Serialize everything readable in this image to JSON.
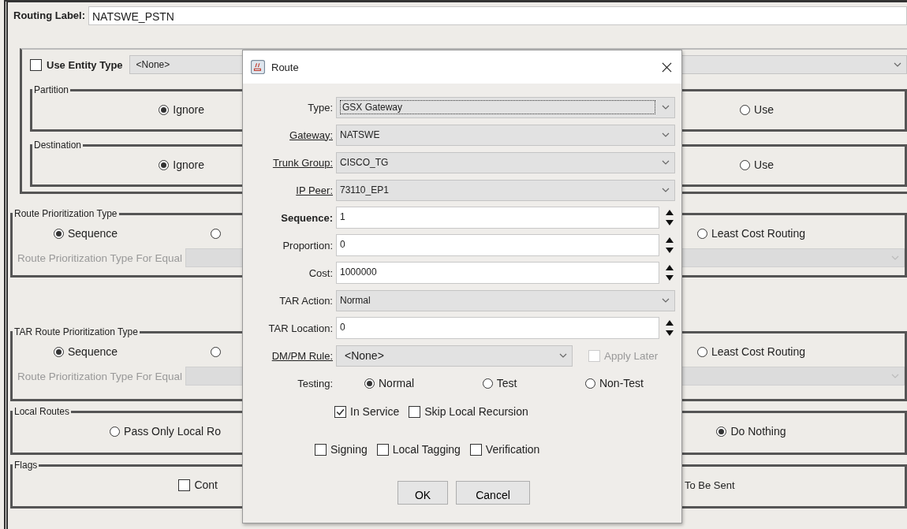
{
  "routing_label": {
    "label": "Routing Label:",
    "value": "NATSWE_PSTN"
  },
  "entity": {
    "use_entity_type": {
      "label": "Use Entity Type",
      "checked": false
    },
    "entity_type": "<None>",
    "groups": [
      {
        "title": "Partition",
        "options": [
          {
            "label": "Ignore",
            "selected": true
          },
          {
            "label": "Use",
            "selected": false
          }
        ]
      },
      {
        "title": "Destination",
        "options": [
          {
            "label": "Ignore",
            "selected": true
          },
          {
            "label": "Use",
            "selected": false
          }
        ]
      }
    ]
  },
  "prioritization": [
    {
      "title": "Route Prioritization Type",
      "options": [
        {
          "label": "Sequence",
          "selected": true
        },
        {
          "selected": false
        },
        {
          "label": "Least Cost Routing",
          "selected": false
        }
      ],
      "equal_cost_label": "Route Prioritization Type For Equal"
    },
    {
      "title": "TAR Route Prioritization Type",
      "options": [
        {
          "label": "Sequence",
          "selected": true
        },
        {
          "selected": false
        },
        {
          "label": "Least Cost Routing",
          "selected": false
        }
      ],
      "equal_cost_label": "Route Prioritization Type For Equal"
    }
  ],
  "local_routes": {
    "title": "Local Routes",
    "options": [
      {
        "label": "Pass Only Local Ro",
        "selected": false
      },
      {
        "label": "Do Nothing",
        "selected": true
      }
    ]
  },
  "flags": {
    "title": "Flags",
    "items": [
      {
        "label": "Cont",
        "checked": false
      }
    ],
    "trailing_text": "To Be Sent"
  },
  "dialog": {
    "title": "Route",
    "fields": [
      {
        "kind": "combo",
        "label": "Type:",
        "value": "GSX Gateway",
        "underlined": false,
        "bold": false,
        "focused": true
      },
      {
        "kind": "combo",
        "label": "Gateway:",
        "value": "NATSWE",
        "underlined": true,
        "bold": false,
        "focused": false
      },
      {
        "kind": "combo",
        "label": "Trunk Group:",
        "value": "CISCO_TG",
        "underlined": true,
        "bold": false,
        "focused": false
      },
      {
        "kind": "combo",
        "label": "IP Peer:",
        "value": "73110_EP1",
        "underlined": true,
        "bold": false,
        "focused": false
      },
      {
        "kind": "spin",
        "label": "Sequence:",
        "value": "1",
        "underlined": false,
        "bold": true,
        "focused": false
      },
      {
        "kind": "spin",
        "label": "Proportion:",
        "value": "0",
        "underlined": false,
        "bold": false,
        "focused": false
      },
      {
        "kind": "spin",
        "label": "Cost:",
        "value": "1000000",
        "underlined": false,
        "bold": false,
        "focused": false
      },
      {
        "kind": "combo",
        "label": "TAR Action:",
        "value": "Normal",
        "underlined": false,
        "bold": false,
        "focused": false
      },
      {
        "kind": "spin",
        "label": "TAR Location:",
        "value": "0",
        "underlined": false,
        "bold": false,
        "focused": false
      },
      {
        "kind": "combo_check",
        "label": "DM/PM Rule:",
        "value": "<None>",
        "underlined": true,
        "bold": false,
        "focused": false,
        "check": {
          "label": "Apply Later",
          "checked": false,
          "disabled": true
        }
      }
    ],
    "testing": {
      "label": "Testing:",
      "options": [
        {
          "label": "Normal",
          "selected": true
        },
        {
          "label": "Test",
          "selected": false
        },
        {
          "label": "Non-Test",
          "selected": false
        }
      ]
    },
    "checkbox_rows": [
      [
        {
          "label": "In Service",
          "checked": true
        },
        {
          "label": "Skip Local Recursion",
          "checked": false
        }
      ],
      [
        {
          "label": "Signing",
          "checked": false
        },
        {
          "label": "Local Tagging",
          "checked": false
        },
        {
          "label": "Verification",
          "checked": false
        }
      ]
    ],
    "buttons": [
      "OK",
      "Cancel"
    ]
  }
}
